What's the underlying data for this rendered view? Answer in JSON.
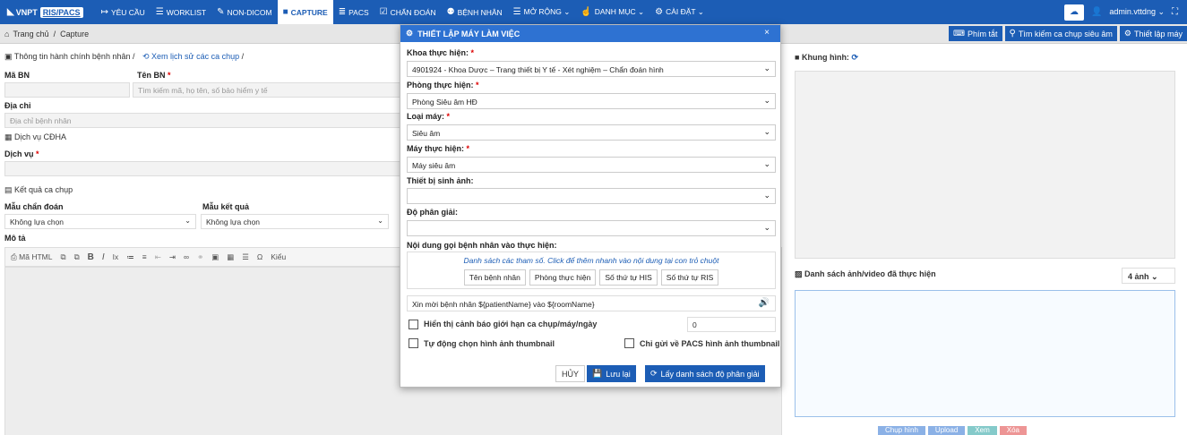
{
  "topbar": {
    "brand": "VNPT",
    "brand_badge": "RIS/PACS",
    "menu": [
      {
        "icon": "↦",
        "label": "YÊU CẦU"
      },
      {
        "icon": "☰",
        "label": "WORKLIST"
      },
      {
        "icon": "✎",
        "label": "NON-DICOM"
      },
      {
        "icon": "■",
        "label": "CAPTURE"
      },
      {
        "icon": "≣",
        "label": "PACS"
      },
      {
        "icon": "☑",
        "label": "CHẨN ĐOÁN"
      },
      {
        "icon": "⚉",
        "label": "BỆNH NHÂN"
      },
      {
        "icon": "☰",
        "label": "MỞ RỘNG ⌄"
      },
      {
        "icon": "☝",
        "label": "DANH MỤC ⌄"
      },
      {
        "icon": "⚙",
        "label": "CÀI ĐẶT ⌄"
      }
    ],
    "user": "admin.vttdng ⌄"
  },
  "breadcrumb": {
    "home": "Trang chủ",
    "sep": "/",
    "current": "Capture"
  },
  "toolbar": {
    "shortcut": "Phím tắt",
    "search": "Tìm kiếm ca chụp siêu âm",
    "settings": "Thiết lập máy"
  },
  "left": {
    "patient_info": "Thông tin hành chính bệnh nhân",
    "history_link": "Xem lịch sử các ca chụp",
    "ma_bn": "Mã BN",
    "ten_bn": "Tên BN",
    "ten_bn_placeholder": "Tìm kiếm mã, họ tên, số bảo hiểm y tế",
    "dia_chi": "Địa chỉ",
    "dia_chi_placeholder": "Địa chỉ bệnh nhân",
    "dich_vu_cdha": "Dịch vụ CĐHA",
    "dich_vu": "Dịch vụ",
    "ket_qua": "Kết quả ca chụp",
    "mau_chan_doan": "Mẫu chẩn đoán",
    "mau_ket_qua": "Mẫu kết quả",
    "khong_lua_chon": "Không lựa chọn",
    "mo_ta": "Mô tả",
    "editor_html": "Mã HTML",
    "editor_kieu": "Kiểu"
  },
  "right": {
    "khung_hinh": "Khung hình:",
    "danh_sach": "Danh sách ảnh/video đã thực hiện",
    "count": "4 ảnh"
  },
  "modal": {
    "title": "THIẾT LẬP MÁY LÀM VIỆC",
    "khoa_label": "Khoa thực hiện:",
    "khoa_value": "4901924 - Khoa Dược – Trang thiết bị Y tế - Xét nghiệm – Chẩn đoán hình",
    "phong_label": "Phòng thực hiện:",
    "phong_value": "Phòng Siêu âm HĐ",
    "loai_label": "Loại máy:",
    "loai_value": "Siêu âm",
    "may_label": "Máy thực hiện:",
    "may_value": "Máy siêu âm",
    "thiet_bi_label": "Thiết bị sinh ảnh:",
    "do_phan_giai_label": "Độ phân giải:",
    "noi_dung_label": "Nội dung gọi bệnh nhân vào thực hiện:",
    "param_hint": "Danh sách các tham số. Click để thêm nhanh vào nội dung tại con trỏ chuột",
    "params": [
      "Tên bệnh nhân",
      "Phòng thực hiện",
      "Số thứ tự HIS",
      "Số thứ tự RIS"
    ],
    "call_text": "Xin mời bệnh nhân ${patientName} vào ${roomName}",
    "warn_label": "Hiển thị cảnh báo giới hạn ca chụp/máy/ngày",
    "warn_value": "0",
    "auto_thumb": "Tự động chọn hình ảnh thumbnail",
    "send_thumb": "Chỉ gửi về PACS hình ảnh thumbnail",
    "cancel": "HỦY",
    "save": "Lưu lại",
    "fetch": "Lấy danh sách độ phân giải"
  },
  "bottom": {
    "capture": "Chụp hình",
    "upload": "Upload",
    "view": "Xem",
    "delete": "Xóa"
  }
}
